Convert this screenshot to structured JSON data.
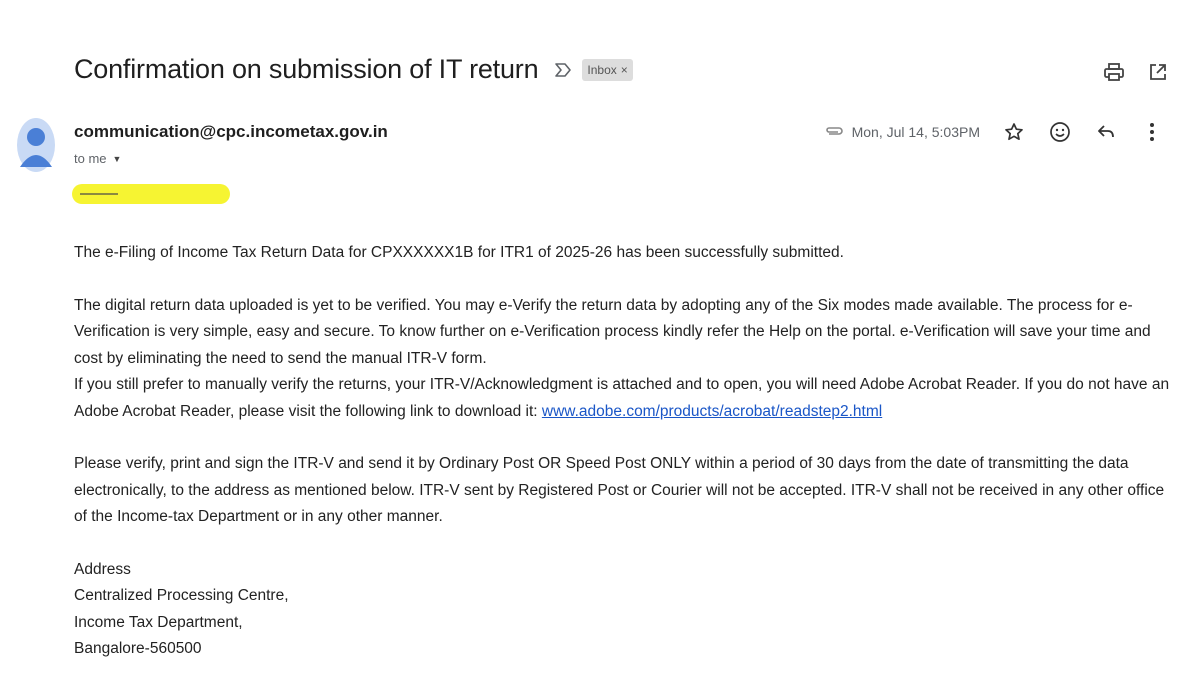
{
  "email": {
    "subject": "Confirmation on submission of IT return",
    "label": "Inbox",
    "label_remove": "×",
    "sender": "communication@cpc.incometax.gov.in",
    "recipient": "to me",
    "date": "Mon, Jul 14, 5:03PM",
    "body": {
      "p1": "The e-Filing of Income Tax Return Data for CPXXXXXX1B for ITR1 of 2025-26 has been successfully submitted.",
      "p2": "The digital return data uploaded is yet to be verified. You may e-Verify the return data by adopting any of the Six modes made available. The process for e-Verification is very simple, easy and secure. To know further on e-Verification process kindly refer the Help on the portal. e-Verification will save your time and cost by eliminating the need to send the manual ITR-V form.",
      "p3_text": "If you still prefer to manually verify the returns, your ITR-V/Acknowledgment is attached and to open, you will need Adobe Acrobat Reader. If you do not have an Adobe Acrobat Reader, please visit the following link to download it:",
      "p3_link": "www.adobe.com/products/acrobat/readstep2.html",
      "p4": "Please verify, print and sign the ITR-V and send it by Ordinary Post OR Speed Post ONLY within a period of 30 days from the date of transmitting the data electronically, to the address as mentioned below. ITR-V sent by Registered Post or Courier will not be accepted. ITR-V shall not be received in any other office of the Income-tax Department or in any other manner.",
      "address": [
        "Address",
        "Centralized Processing Centre,",
        "Income Tax Department,",
        "Bangalore-560500"
      ]
    }
  },
  "icons": {
    "important": "important-marker-icon",
    "print": "print-icon",
    "open_new_window": "open-in-new-window-icon",
    "attachment": "attachment-icon",
    "star": "star-icon",
    "emoji": "emoji-reaction-icon",
    "reply": "reply-icon",
    "more": "more-vert-icon",
    "avatar": "avatar-icon"
  },
  "colors": {
    "link": "#1a56c7",
    "avatar": "#4a7fd6",
    "redaction_highlight": "#f6f432"
  }
}
